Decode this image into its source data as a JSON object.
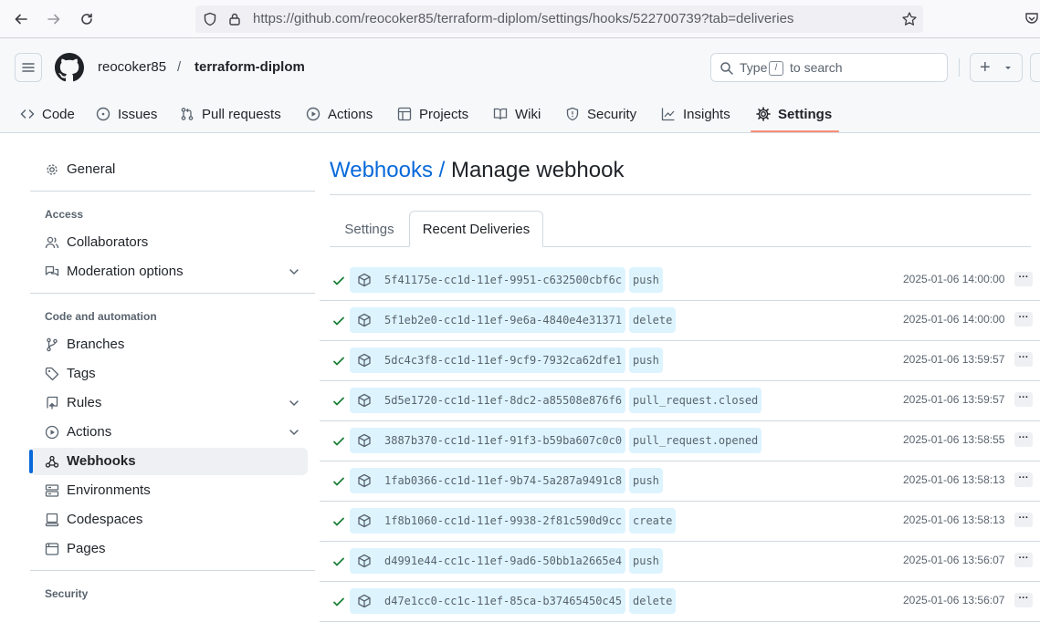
{
  "browser": {
    "url": "https://github.com/reocoker85/terraform-diplom/settings/hooks/522700739?tab=deliveries"
  },
  "header": {
    "owner": "reocoker85",
    "separator": "/",
    "repo": "terraform-diplom",
    "search": {
      "type": "Type",
      "key": "/",
      "suffix": "to search"
    },
    "new_button": "+"
  },
  "repo_tabs": [
    {
      "label": "Code",
      "icon": "code-icon"
    },
    {
      "label": "Issues",
      "icon": "issue-opened-icon"
    },
    {
      "label": "Pull requests",
      "icon": "git-pull-request-icon"
    },
    {
      "label": "Actions",
      "icon": "play-icon"
    },
    {
      "label": "Projects",
      "icon": "table-icon"
    },
    {
      "label": "Wiki",
      "icon": "book-icon"
    },
    {
      "label": "Security",
      "icon": "shield-icon"
    },
    {
      "label": "Insights",
      "icon": "graph-icon"
    },
    {
      "label": "Settings",
      "icon": "gear-icon",
      "active": true
    }
  ],
  "sidebar": {
    "general": "General",
    "access_heading": "Access",
    "access": [
      {
        "label": "Collaborators",
        "icon": "people-icon"
      },
      {
        "label": "Moderation options",
        "icon": "comment-discussion-icon",
        "expandable": true
      }
    ],
    "code_heading": "Code and automation",
    "code": [
      {
        "label": "Branches",
        "icon": "git-branch-icon"
      },
      {
        "label": "Tags",
        "icon": "tag-icon"
      },
      {
        "label": "Rules",
        "icon": "repo-push-icon",
        "expandable": true
      },
      {
        "label": "Actions",
        "icon": "play-icon",
        "expandable": true
      },
      {
        "label": "Webhooks",
        "icon": "webhook-icon",
        "active": true
      },
      {
        "label": "Environments",
        "icon": "server-icon"
      },
      {
        "label": "Codespaces",
        "icon": "codespaces-icon"
      },
      {
        "label": "Pages",
        "icon": "browser-icon"
      }
    ],
    "security_heading": "Security"
  },
  "main": {
    "breadcrumb": "Webhooks /",
    "title": "Manage webhook",
    "tabs": {
      "settings": "Settings",
      "recent": "Recent Deliveries"
    }
  },
  "deliveries": [
    {
      "guid": "5f41175e-cc1d-11ef-9951-c632500cbf6c",
      "event": "push",
      "time": "2025-01-06 14:00:00"
    },
    {
      "guid": "5f1eb2e0-cc1d-11ef-9e6a-4840e4e31371",
      "event": "delete",
      "time": "2025-01-06 14:00:00"
    },
    {
      "guid": "5dc4c3f8-cc1d-11ef-9cf9-7932ca62dfe1",
      "event": "push",
      "time": "2025-01-06 13:59:57"
    },
    {
      "guid": "5d5e1720-cc1d-11ef-8dc2-a85508e876f6",
      "event": "pull_request.closed",
      "time": "2025-01-06 13:59:57"
    },
    {
      "guid": "3887b370-cc1d-11ef-91f3-b59ba607c0c0",
      "event": "pull_request.opened",
      "time": "2025-01-06 13:58:55"
    },
    {
      "guid": "1fab0366-cc1d-11ef-9b74-5a287a9491c8",
      "event": "push",
      "time": "2025-01-06 13:58:13"
    },
    {
      "guid": "1f8b1060-cc1d-11ef-9938-2f81c590d9cc",
      "event": "create",
      "time": "2025-01-06 13:58:13"
    },
    {
      "guid": "d4991e44-cc1c-11ef-9ad6-50bb1a2665e4",
      "event": "push",
      "time": "2025-01-06 13:56:07"
    },
    {
      "guid": "d47e1cc0-cc1c-11ef-85ca-b37465450c45",
      "event": "delete",
      "time": "2025-01-06 13:56:07"
    }
  ],
  "colors": {
    "accent": "#0969da",
    "success": "#1a7f37",
    "tab_underline": "#fd8c73",
    "pill_bg": "#ddf4ff"
  }
}
